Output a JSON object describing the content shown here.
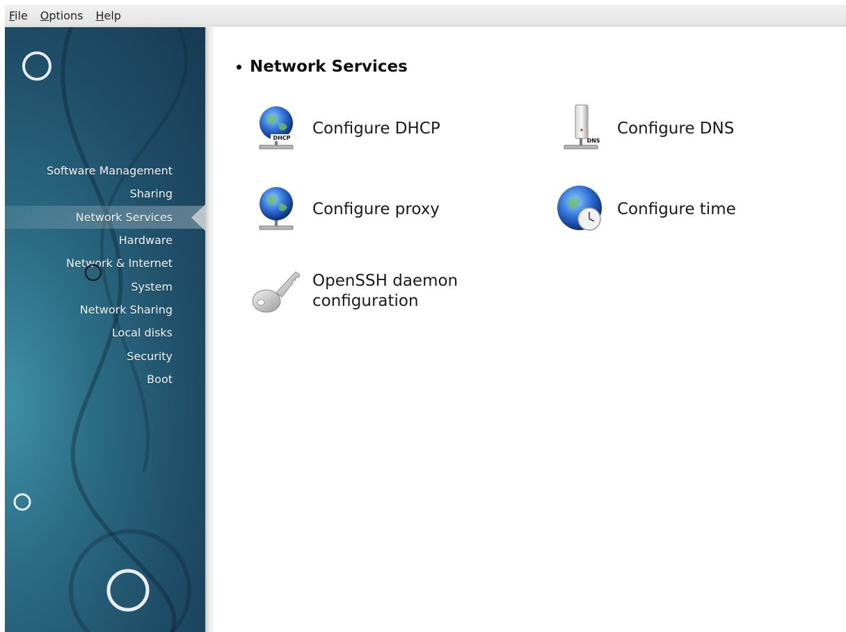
{
  "menubar": {
    "items": [
      {
        "mnemonic": "F",
        "rest": "ile"
      },
      {
        "mnemonic": "O",
        "rest": "ptions"
      },
      {
        "mnemonic": "H",
        "rest": "elp"
      }
    ]
  },
  "sidebar": {
    "items": [
      {
        "label": "Software Management"
      },
      {
        "label": "Sharing"
      },
      {
        "label": "Network Services",
        "active": true
      },
      {
        "label": "Hardware"
      },
      {
        "label": "Network & Internet"
      },
      {
        "label": "System"
      },
      {
        "label": "Network Sharing"
      },
      {
        "label": "Local disks"
      },
      {
        "label": "Security"
      },
      {
        "label": "Boot"
      }
    ]
  },
  "main": {
    "section_title": "Network Services",
    "tools": [
      {
        "label": "Configure DHCP",
        "icon": "globe-dhcp-icon",
        "badge": "DHCP"
      },
      {
        "label": "Configure DNS",
        "icon": "dns-server-icon",
        "badge": "DNS"
      },
      {
        "label": "Configure proxy",
        "icon": "globe-proxy-icon"
      },
      {
        "label": "Configure time",
        "icon": "globe-clock-icon"
      },
      {
        "label": "OpenSSH daemon configuration",
        "icon": "key-icon"
      }
    ]
  },
  "colors": {
    "sidebar_dark": "#173a52",
    "sidebar_light": "#3f91a8",
    "globe_blue": "#2f6fd6"
  }
}
